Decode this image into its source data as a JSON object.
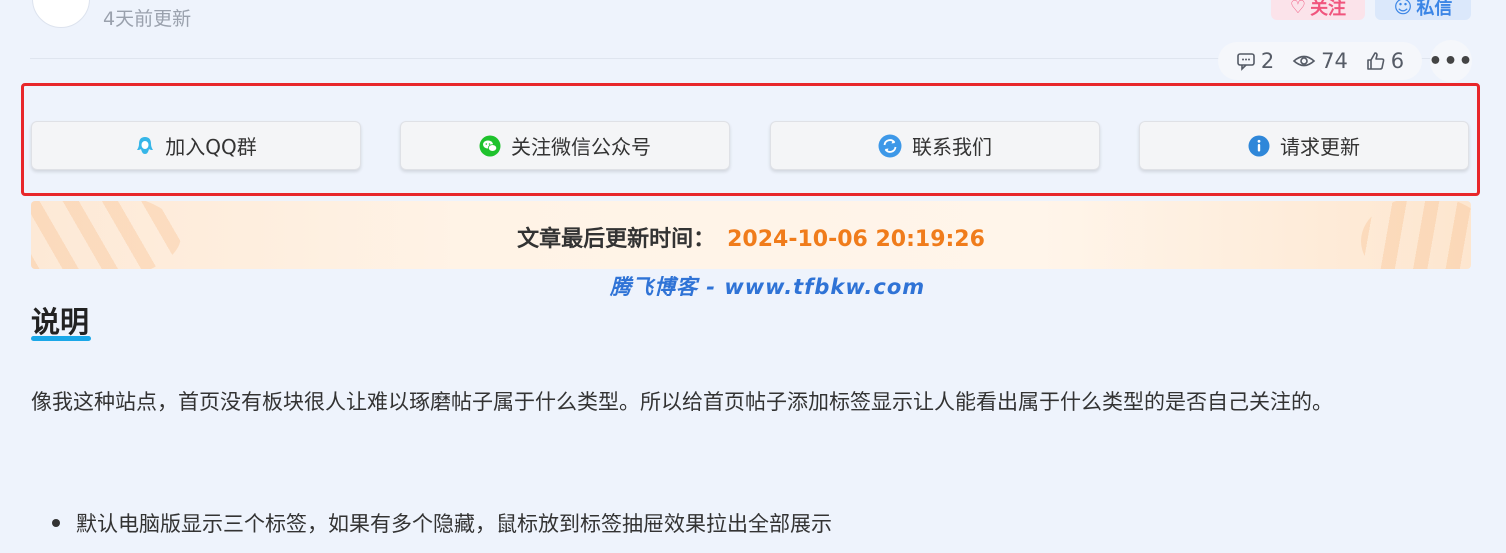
{
  "header": {
    "updated": "4天前更新",
    "follow_label": "关注",
    "message_label": "私信"
  },
  "stats": {
    "comments": "2",
    "views": "74",
    "likes": "6",
    "more": "•••"
  },
  "actions": [
    {
      "label": "加入QQ群",
      "icon": "qq-icon",
      "color": "#36b6e8"
    },
    {
      "label": "关注微信公众号",
      "icon": "wechat-icon",
      "color": "#1ec22d"
    },
    {
      "label": "联系我们",
      "icon": "refresh-circle-icon",
      "color": "#3d98e8"
    },
    {
      "label": "请求更新",
      "icon": "info-icon",
      "color": "#2f87d9"
    }
  ],
  "update_banner": {
    "label": "文章最后更新时间：",
    "date": "2024-10-06 20:19:26"
  },
  "watermark": "腾飞博客 - www.tfbkw.com",
  "section": {
    "title": "说明",
    "paragraph": "像我这种站点，首页没有板块很人让难以琢磨帖子属于什么类型。所以给首页帖子添加标签显示让人能看出属于什么类型的是否自己关注的。",
    "bullets": [
      "默认电脑版显示三个标签，如果有多个隐藏，鼠标放到标签抽屉效果拉出全部展示"
    ]
  },
  "colors": {
    "highlight_border": "#e8262a",
    "date_accent": "#f07c1b",
    "title_underline": "#1aa7e8"
  }
}
